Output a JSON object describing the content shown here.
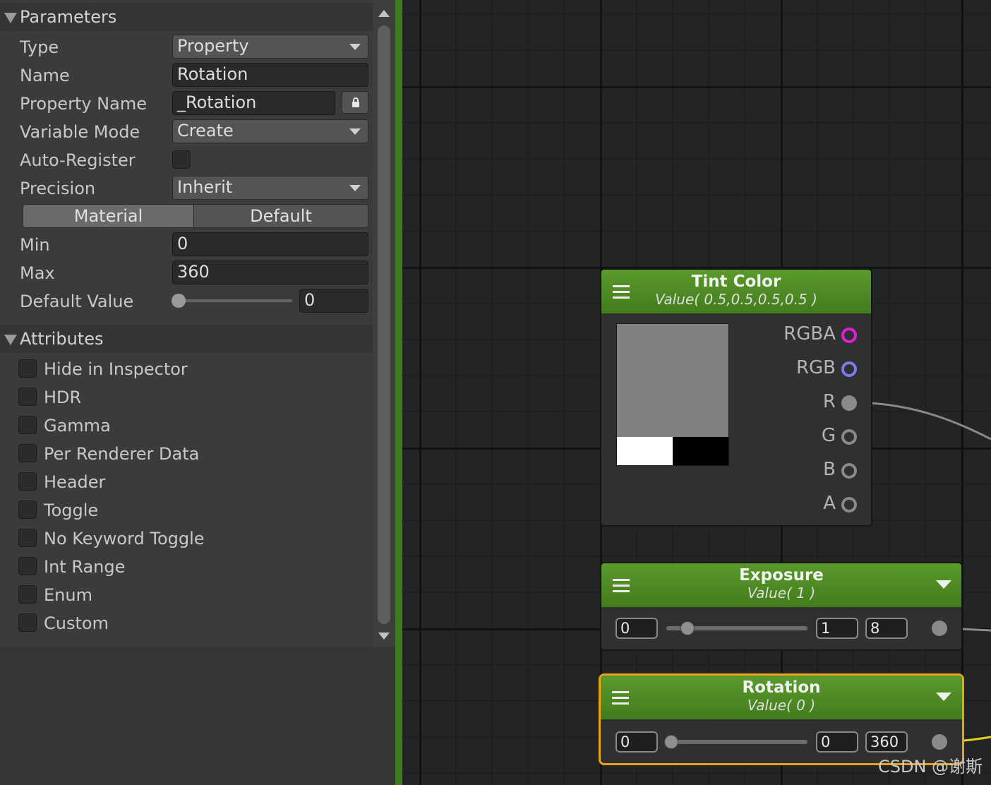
{
  "parameters": {
    "header": "Parameters",
    "type": {
      "label": "Type",
      "value": "Property"
    },
    "name": {
      "label": "Name",
      "value": "Rotation"
    },
    "property_name": {
      "label": "Property Name",
      "value": "_Rotation"
    },
    "variable_mode": {
      "label": "Variable Mode",
      "value": "Create"
    },
    "auto_register": {
      "label": "Auto-Register",
      "checked": false
    },
    "precision": {
      "label": "Precision",
      "value": "Inherit"
    },
    "tabs": [
      "Material",
      "Default"
    ],
    "active_tab": "Material",
    "min": {
      "label": "Min",
      "value": "0"
    },
    "max": {
      "label": "Max",
      "value": "360"
    },
    "default_value": {
      "label": "Default Value",
      "value": "0"
    }
  },
  "attributes": {
    "header": "Attributes",
    "items": [
      {
        "label": "Hide in Inspector",
        "checked": false
      },
      {
        "label": "HDR",
        "checked": false
      },
      {
        "label": "Gamma",
        "checked": false
      },
      {
        "label": "Per Renderer Data",
        "checked": false
      },
      {
        "label": "Header",
        "checked": false
      },
      {
        "label": "Toggle",
        "checked": false
      },
      {
        "label": "No Keyword Toggle",
        "checked": false
      },
      {
        "label": "Int Range",
        "checked": false
      },
      {
        "label": "Enum",
        "checked": false
      },
      {
        "label": "Custom",
        "checked": false
      }
    ]
  },
  "nodes": {
    "tint_color": {
      "title": "Tint Color",
      "subtitle": "Value( 0.5,0.5,0.5,0.5 )",
      "ports": [
        "RGBA",
        "RGB",
        "R",
        "G",
        "B",
        "A"
      ],
      "swatch_color": "#808080",
      "port_colors": {
        "rgba": "#e21fd6",
        "rgb": "#7b7bea",
        "channel": "#8a8a8a"
      }
    },
    "exposure": {
      "title": "Exposure",
      "subtitle": "Value( 1 )",
      "min": "0",
      "value": "1",
      "max": "8"
    },
    "rotation": {
      "title": "Rotation",
      "subtitle": "Value( 0 )",
      "min": "0",
      "value": "0",
      "max": "360",
      "selected": true
    }
  },
  "colors": {
    "node_header_green": "#4c8a22",
    "selection_orange": "#e8a317",
    "wire_yellow": "#e6cf19"
  },
  "watermark": "CSDN @谢斯"
}
